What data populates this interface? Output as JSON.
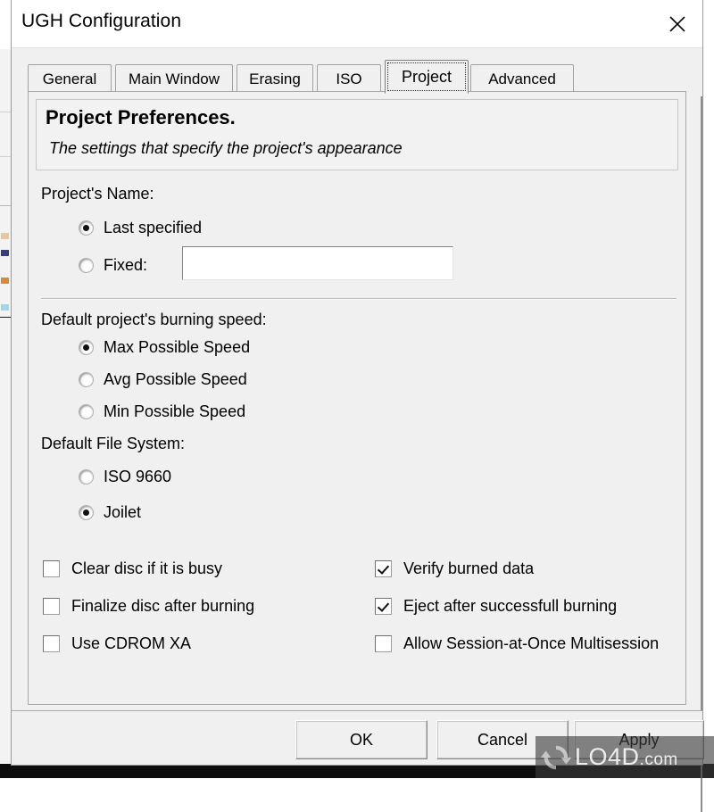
{
  "window": {
    "title": "UGH Configuration",
    "close_icon": "close-icon",
    "close_glyph": "✕"
  },
  "tabs": [
    {
      "label": "General",
      "selected": false
    },
    {
      "label": "Main Window",
      "selected": false
    },
    {
      "label": "Erasing",
      "selected": false
    },
    {
      "label": "ISO",
      "selected": false
    },
    {
      "label": "Project",
      "selected": true
    },
    {
      "label": "Advanced",
      "selected": false
    }
  ],
  "page": {
    "header": {
      "title": "Project Preferences.",
      "subtitle": "The settings that specify the project's appearance"
    },
    "project_name": {
      "label": "Project's Name:",
      "options": [
        {
          "label": "Last specified",
          "selected": true
        },
        {
          "label": "Fixed:",
          "selected": false
        }
      ],
      "fixed_value": "",
      "fixed_placeholder": ""
    },
    "burning_speed": {
      "label": "Default project's burning speed:",
      "options": [
        {
          "label": "Max Possible Speed",
          "selected": true
        },
        {
          "label": "Avg Possible Speed",
          "selected": false
        },
        {
          "label": "Min Possible Speed",
          "selected": false
        }
      ]
    },
    "file_system": {
      "label": "Default File System:",
      "options": [
        {
          "label": "ISO 9660",
          "selected": false
        },
        {
          "label": "Joilet",
          "selected": true
        }
      ]
    },
    "checkboxes_left": [
      {
        "label": "Clear disc if it is busy",
        "checked": false
      },
      {
        "label": "Finalize disc after burning",
        "checked": false
      },
      {
        "label": "Use CDROM XA",
        "checked": false
      }
    ],
    "checkboxes_right": [
      {
        "label": "Verify burned data",
        "checked": true
      },
      {
        "label": "Eject after successfull burning",
        "checked": true
      },
      {
        "label": "Allow Session-at-Once Multisession",
        "checked": false
      }
    ]
  },
  "buttons": {
    "ok": "OK",
    "cancel": "Cancel",
    "apply": "Apply"
  },
  "watermark": {
    "name": "LO4D",
    "suffix": ".com",
    "logo_icon": "refresh-circle-icon"
  },
  "colors": {
    "dialog_face": "#f0f0f0",
    "titlebar": "#ffffff",
    "border": "#9b9b9b",
    "text": "#000000",
    "field_bg": "#ffffff"
  }
}
